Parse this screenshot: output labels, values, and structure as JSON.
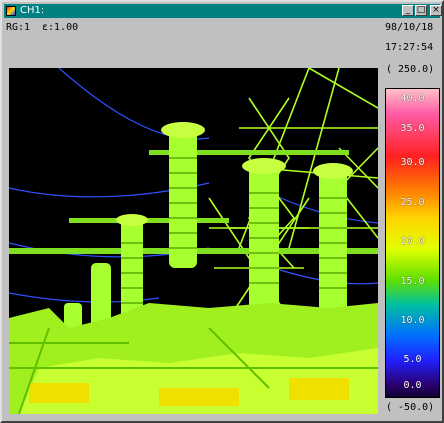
{
  "window": {
    "title": "CH1:",
    "min_glyph": "_",
    "max_glyph": "□",
    "close_glyph": "×"
  },
  "header": {
    "range": "RG:1",
    "emissivity": "ε:1.00",
    "date": "98/10/18",
    "time": "17:27:54"
  },
  "scale": {
    "max_label": "( 250.0)",
    "min_label": "( -50.0)",
    "ticks": [
      "40.0",
      "35.0",
      "30.0",
      "25.0",
      "20.0",
      "15.0",
      "10.0",
      "5.0",
      "0.0"
    ]
  },
  "icons": {
    "app": "thermal-camera-icon",
    "minimize": "minimize-icon",
    "maximize": "maximize-icon",
    "close": "close-icon"
  },
  "colors": {
    "titlebar": "#008080",
    "window": "#c0c0c0",
    "image_background": "#000000",
    "hot": "#ff2020",
    "warm": "#ffd400",
    "mid": "#a0ff00",
    "cool": "#0070ff"
  }
}
